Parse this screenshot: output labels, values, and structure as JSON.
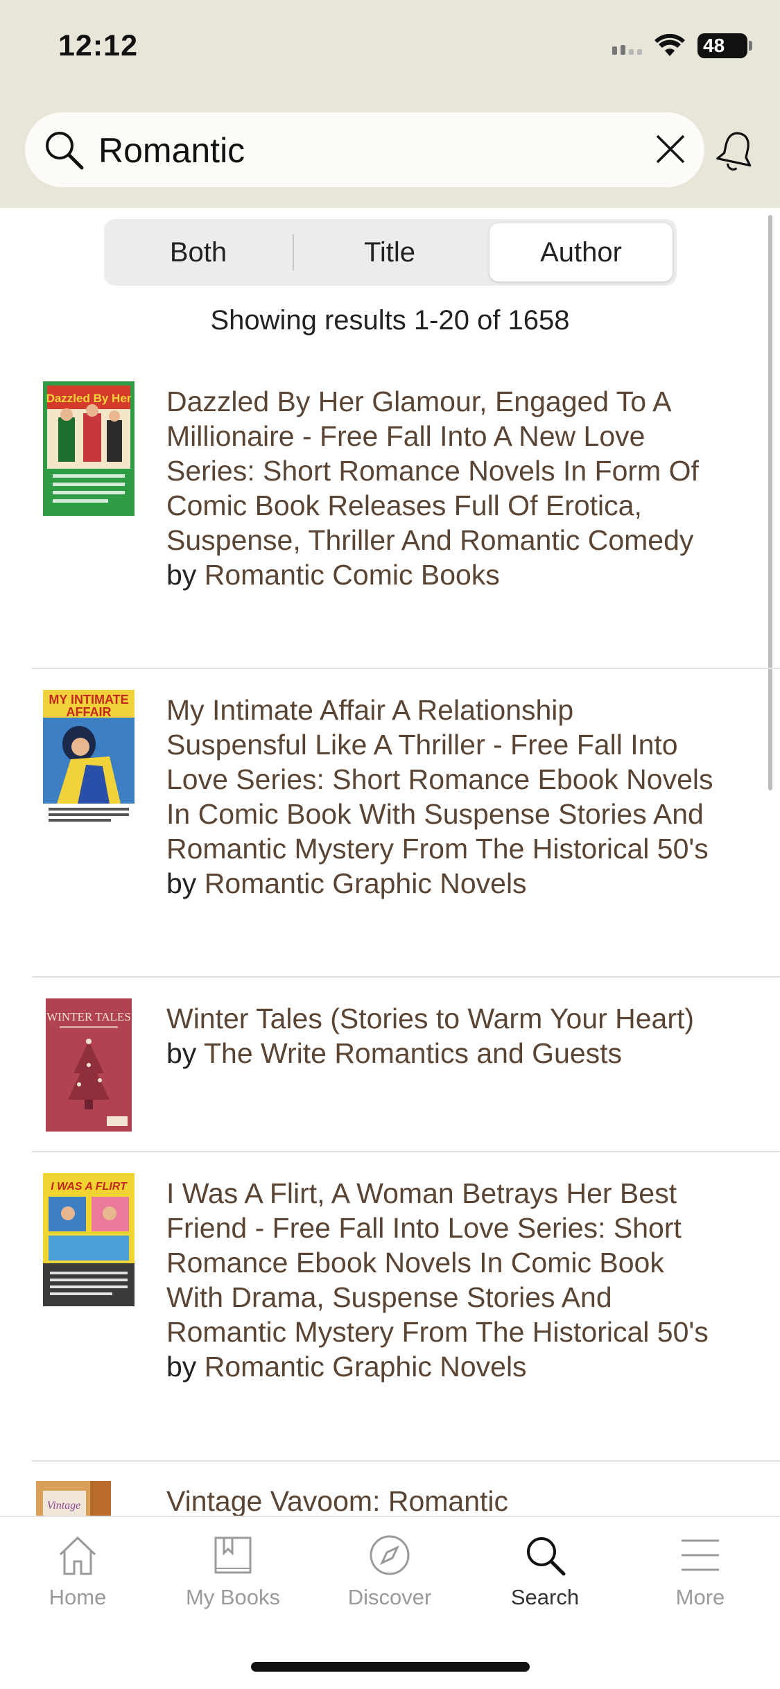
{
  "status_bar": {
    "time": "12:12",
    "battery": "48"
  },
  "search": {
    "value": "Romantic",
    "icon": "search-icon",
    "clear_icon": "close-icon",
    "bell_icon": "bell-icon"
  },
  "segments": {
    "both": "Both",
    "title": "Title",
    "author": "Author",
    "selected": "Author"
  },
  "results_text": "Showing results 1-20 of 1658",
  "books": [
    {
      "title": "Dazzled By Her Glamour, Engaged To A Millionaire - Free Fall Into A New Love Series: Short Romance Novels In Form Of Comic Book Releases Full Of Erotica, Suspense, Thriller And Romantic Comedy",
      "by": "by",
      "author": "Romantic Comic Books",
      "cover_text": "Dazzled By Her Glamour",
      "cover_colors": {
        "bg": "#2e9b45",
        "accent": "#d43b2a"
      }
    },
    {
      "title": "My Intimate Affair A Relationship Suspensful Like A Thriller - Free Fall Into Love Series: Short Romance Ebook Novels In Comic Book With Suspense Stories And Romantic Mystery From The Historical 50's",
      "by": "by",
      "author": "Romantic Graphic Novels",
      "cover_text": "MY INTIMATE AFFAIR",
      "cover_colors": {
        "bg": "#c2281d",
        "accent": "#f2d23a"
      }
    },
    {
      "title": "Winter Tales (Stories to Warm Your Heart)",
      "by": "by",
      "author": "The Write Romantics and Guests",
      "cover_text": "WINTER TALES",
      "cover_colors": {
        "bg": "#b0434f",
        "accent": "#f0e0d0"
      }
    },
    {
      "title": "I Was A Flirt, A Woman Betrays Her Best Friend - Free Fall Into Love Series: Short Romance Ebook Novels In Comic Book With Drama, Suspense Stories And Romantic Mystery From The Historical 50's",
      "by": "by",
      "author": "Romantic Graphic Novels",
      "cover_text": "I WAS A FLIRT",
      "cover_colors": {
        "bg": "#f1d332",
        "accent": "#3a3a3a"
      }
    },
    {
      "title": "Vintage Vavoom: Romantic",
      "cover_text": "Vintage",
      "cover_colors": {
        "bg": "#d9a05a",
        "accent": "#8a4a8f"
      }
    }
  ],
  "tabs": [
    {
      "label": "Home",
      "icon": "home-icon"
    },
    {
      "label": "My Books",
      "icon": "book-icon"
    },
    {
      "label": "Discover",
      "icon": "compass-icon"
    },
    {
      "label": "Search",
      "icon": "search-icon"
    },
    {
      "label": "More",
      "icon": "menu-icon"
    }
  ],
  "active_tab": "Search",
  "colors": {
    "header_bg": "#e8e5d9",
    "title_brown": "#5a4535",
    "tab_inactive": "#9a9a9a"
  }
}
